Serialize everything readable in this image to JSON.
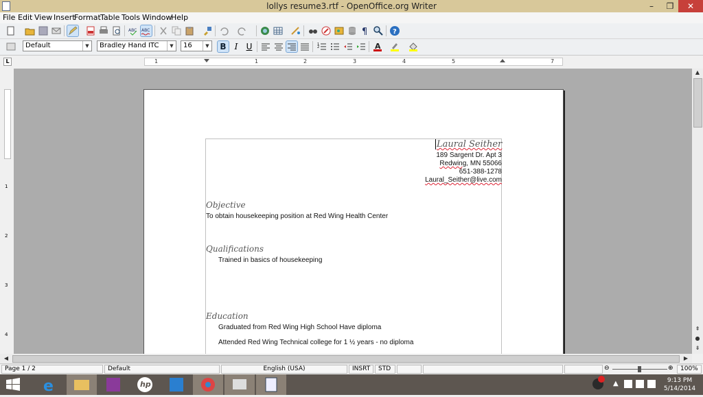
{
  "window": {
    "title": "lollys resume3.rtf - OpenOffice.org Writer",
    "min_glyph": "–",
    "max_glyph": "❐",
    "close_glyph": "✕"
  },
  "menu": [
    "File",
    "Edit",
    "View",
    "Insert",
    "Format",
    "Table",
    "Tools",
    "Window",
    "Help"
  ],
  "formatting": {
    "style": "Default",
    "font": "Bradley Hand ITC",
    "size": "16",
    "bold_label": "B",
    "italic_label": "I",
    "underline_label": "U"
  },
  "ruler": {
    "labels": [
      "1",
      "1",
      "2",
      "3",
      "4",
      "5",
      "7"
    ],
    "corner": "L"
  },
  "document": {
    "name": "Laural Seither",
    "address1": "189 Sargent Dr. Apt 3",
    "city_prefix": "Redwing",
    "city_rest": ", MN 55066",
    "phone": "651-388-1278",
    "email": "Laural_Seither@live.com",
    "sections": [
      {
        "heading": "Objective",
        "lines": [
          "To obtain housekeeping position at Red Wing Health Center"
        ]
      },
      {
        "heading": "Qualifications",
        "lines": [
          "Trained in basics of housekeeping"
        ]
      },
      {
        "heading": "Education",
        "lines": [
          "Graduated from Red Wing High School Have diploma",
          "Attended Red Wing Technical college for 1 ½ years - no diploma"
        ]
      }
    ]
  },
  "vruler_labels": [
    "1",
    "2",
    "3",
    "4"
  ],
  "status": {
    "page": "Page 1 / 2",
    "style": "Default",
    "language": "English (USA)",
    "insert_mode": "INSRT",
    "selection_mode": "STD",
    "zoom": "100%"
  },
  "taskbar": {
    "time": "9:13 PM",
    "date": "5/14/2014",
    "hp_label": "hp"
  },
  "colors": {
    "titlebar": "#d8c89a",
    "close": "#c7403a",
    "doc_background": "#acacac",
    "taskbar": "#5d5650",
    "spell_error": "#dd2233"
  }
}
